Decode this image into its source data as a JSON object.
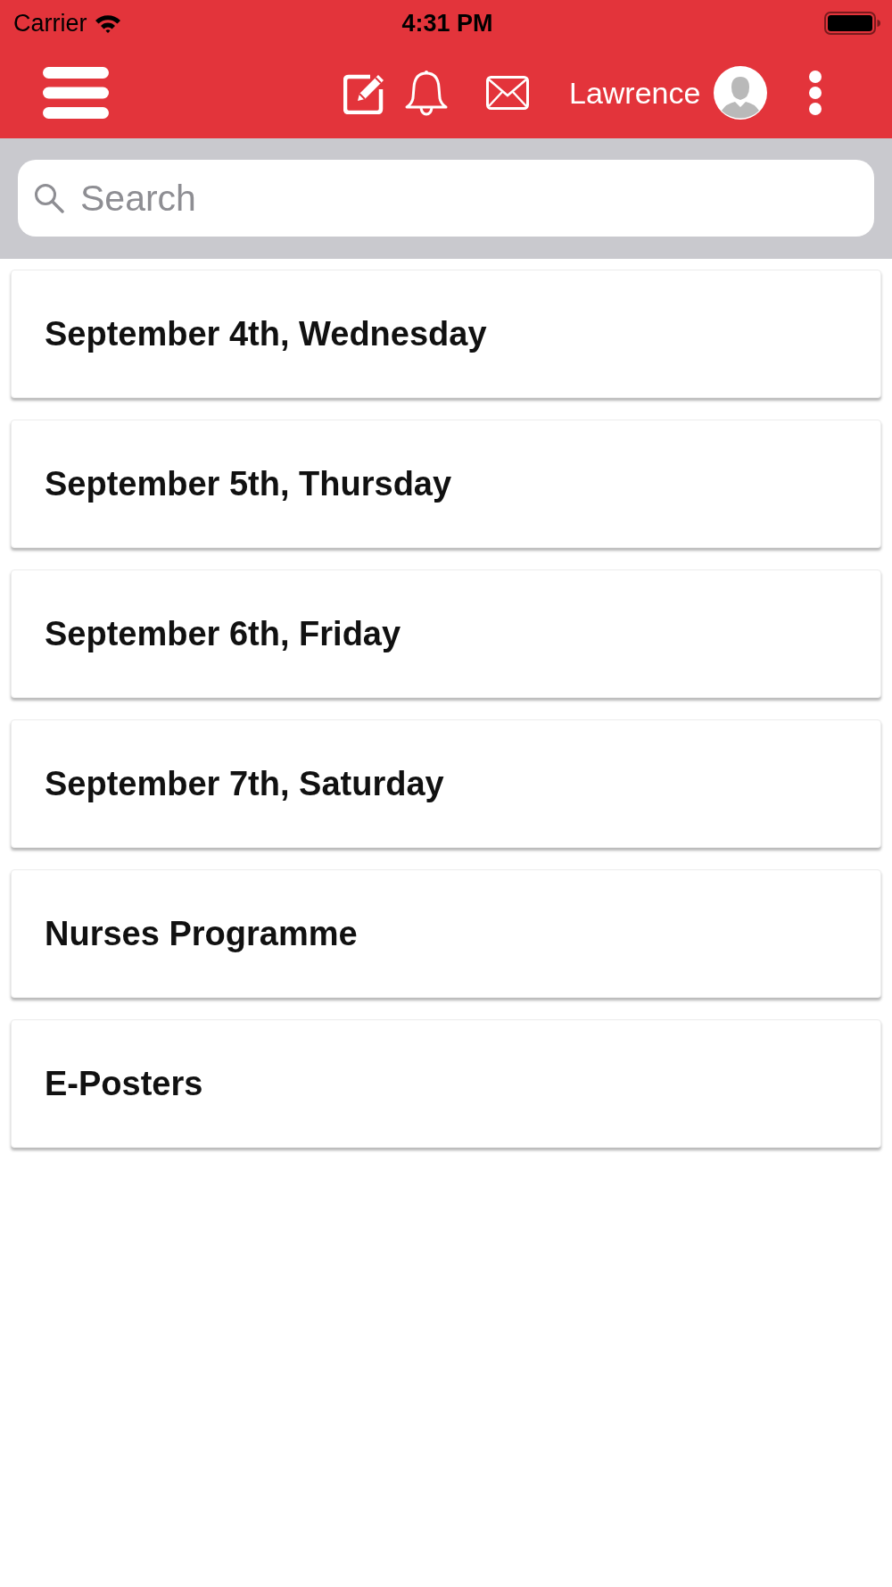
{
  "status_bar": {
    "carrier": "Carrier",
    "time": "4:31 PM"
  },
  "header": {
    "user_name": "Lawrence"
  },
  "search": {
    "placeholder": "Search"
  },
  "items": [
    {
      "label": "September 4th, Wednesday"
    },
    {
      "label": "September 5th, Thursday"
    },
    {
      "label": "September 6th, Friday"
    },
    {
      "label": "September 7th, Saturday"
    },
    {
      "label": "Nurses Programme"
    },
    {
      "label": "E-Posters"
    }
  ]
}
